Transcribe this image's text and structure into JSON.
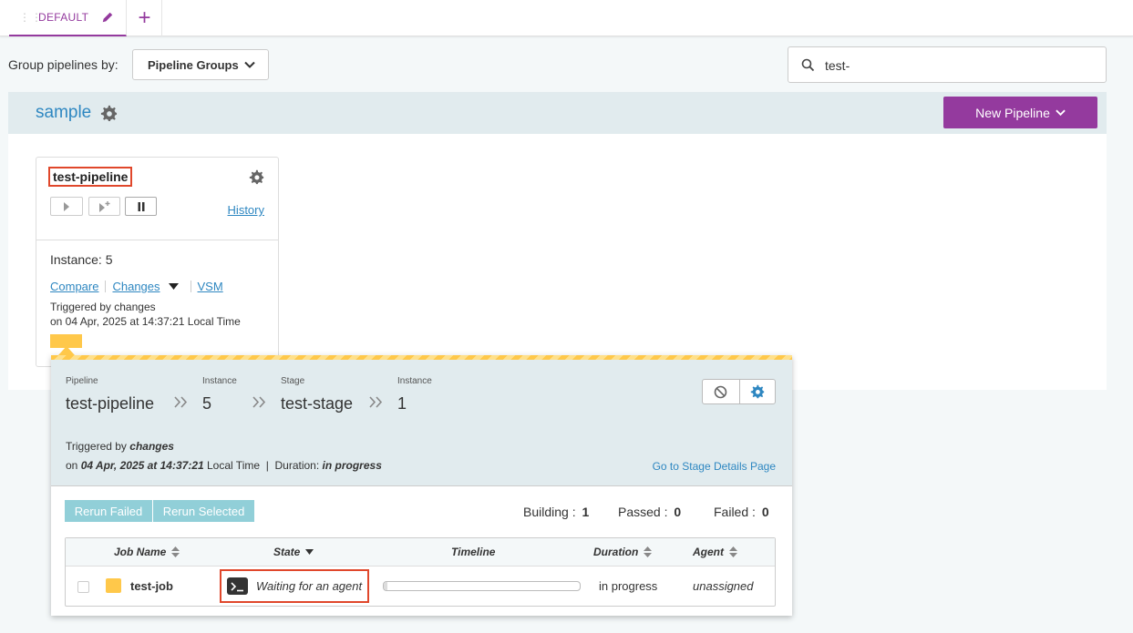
{
  "tabs": [
    {
      "label": "DEFAULT"
    }
  ],
  "toolbar": {
    "group_by_label": "Group pipelines by:",
    "group_by_value": "Pipeline Groups",
    "search_value": "test-"
  },
  "group": {
    "name": "sample",
    "new_pipeline_label": "New Pipeline"
  },
  "pipeline_card": {
    "name": "test-pipeline",
    "history_label": "History",
    "instance_label": "Instance: 5",
    "links": {
      "compare": "Compare",
      "changes": "Changes",
      "vsm": "VSM"
    },
    "triggered_by": "Triggered by changes",
    "triggered_on": "on 04 Apr, 2025 at 14:37:21 Local Time",
    "stage_status_color": "#ffc84a"
  },
  "stage_popup": {
    "crumbs": [
      {
        "label": "Pipeline",
        "value": "test-pipeline"
      },
      {
        "label": "Instance",
        "value": "5"
      },
      {
        "label": "Stage",
        "value": "test-stage"
      },
      {
        "label": "Instance",
        "value": "1"
      }
    ],
    "triggered_prefix": "Triggered by ",
    "triggered_by": "changes",
    "on_prefix": "on ",
    "on_date": "04 Apr, 2025 at 14:37:21",
    "local_time": " Local Time",
    "duration_prefix": "Duration: ",
    "duration_value": "in progress",
    "stage_details_link": "Go to Stage Details Page",
    "rerun_failed": "Rerun Failed",
    "rerun_selected": "Rerun Selected",
    "counts": {
      "building_label": "Building :",
      "building": "1",
      "passed_label": "Passed :",
      "passed": "0",
      "failed_label": "Failed :",
      "failed": "0"
    },
    "table": {
      "headers": {
        "job_name": "Job Name",
        "state": "State",
        "timeline": "Timeline",
        "duration": "Duration",
        "agent": "Agent"
      },
      "rows": [
        {
          "job_name": "test-job",
          "state": "Waiting for an agent",
          "duration": "in progress",
          "agent": "unassigned",
          "progress": 0.02
        }
      ]
    }
  },
  "colors": {
    "accent": "#943a9e",
    "link": "#2e87c1",
    "building": "#ffc84a",
    "highlight": "#e0472b",
    "rerun": "#91cfd8"
  }
}
